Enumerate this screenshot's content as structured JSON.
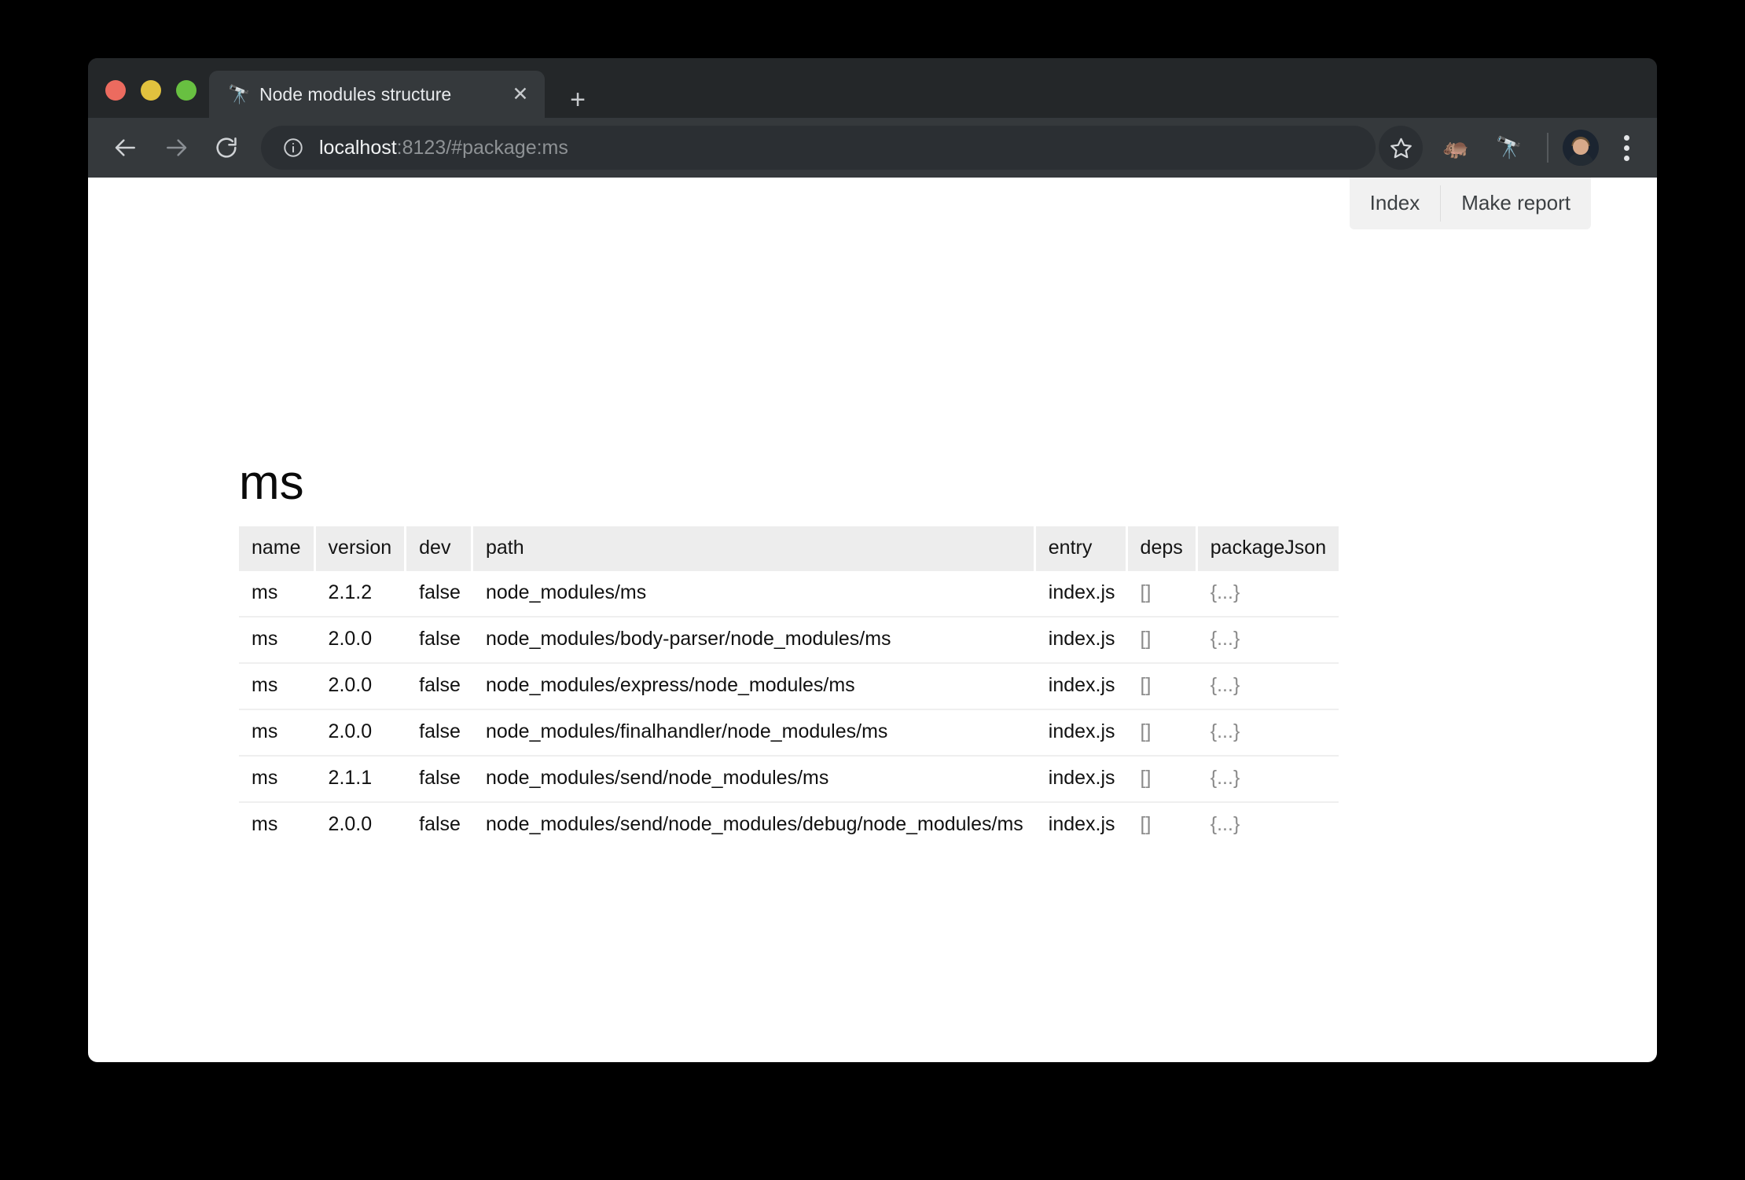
{
  "window": {
    "traffic_lights": {
      "close_color": "#EC6B5F",
      "minimize_color": "#E2C23E",
      "zoom_color": "#68C041"
    }
  },
  "tab_strip": {
    "tabs": [
      {
        "favicon": "🔭",
        "title": "Node modules structure",
        "close_label": "✕"
      }
    ],
    "new_tab_label": "+"
  },
  "toolbar": {
    "back_icon": "arrow-left-icon",
    "forward_icon": "arrow-right-icon",
    "reload_icon": "reload-icon",
    "site_info_icon": "info-circle-icon",
    "url": {
      "host": "localhost",
      "rest": ":8123/#package:ms",
      "full": "localhost:8123/#package:ms"
    },
    "bookmark_icon": "star-icon",
    "extensions": [
      {
        "icon": "🦛",
        "name": "hippo-extension-icon"
      },
      {
        "icon": "🔭",
        "name": "telescope-extension-icon"
      }
    ],
    "profile_name": "avatar",
    "menu_icon": "three-dot-menu-icon"
  },
  "page": {
    "actions": [
      {
        "label": "Index"
      },
      {
        "label": "Make report"
      }
    ],
    "title": "ms",
    "table": {
      "columns": [
        "name",
        "version",
        "dev",
        "path",
        "entry",
        "deps",
        "packageJson"
      ],
      "rows": [
        {
          "name": "ms",
          "version": "2.1.2",
          "dev": "false",
          "path": "node_modules/ms",
          "entry": "index.js",
          "deps": "[]",
          "packageJson": "{...}"
        },
        {
          "name": "ms",
          "version": "2.0.0",
          "dev": "false",
          "path": "node_modules/body-parser/node_modules/ms",
          "entry": "index.js",
          "deps": "[]",
          "packageJson": "{...}"
        },
        {
          "name": "ms",
          "version": "2.0.0",
          "dev": "false",
          "path": "node_modules/express/node_modules/ms",
          "entry": "index.js",
          "deps": "[]",
          "packageJson": "{...}"
        },
        {
          "name": "ms",
          "version": "2.0.0",
          "dev": "false",
          "path": "node_modules/finalhandler/node_modules/ms",
          "entry": "index.js",
          "deps": "[]",
          "packageJson": "{...}"
        },
        {
          "name": "ms",
          "version": "2.1.1",
          "dev": "false",
          "path": "node_modules/send/node_modules/ms",
          "entry": "index.js",
          "deps": "[]",
          "packageJson": "{...}"
        },
        {
          "name": "ms",
          "version": "2.0.0",
          "dev": "false",
          "path": "node_modules/send/node_modules/debug/node_modules/ms",
          "entry": "index.js",
          "deps": "[]",
          "packageJson": "{...}"
        }
      ]
    }
  }
}
